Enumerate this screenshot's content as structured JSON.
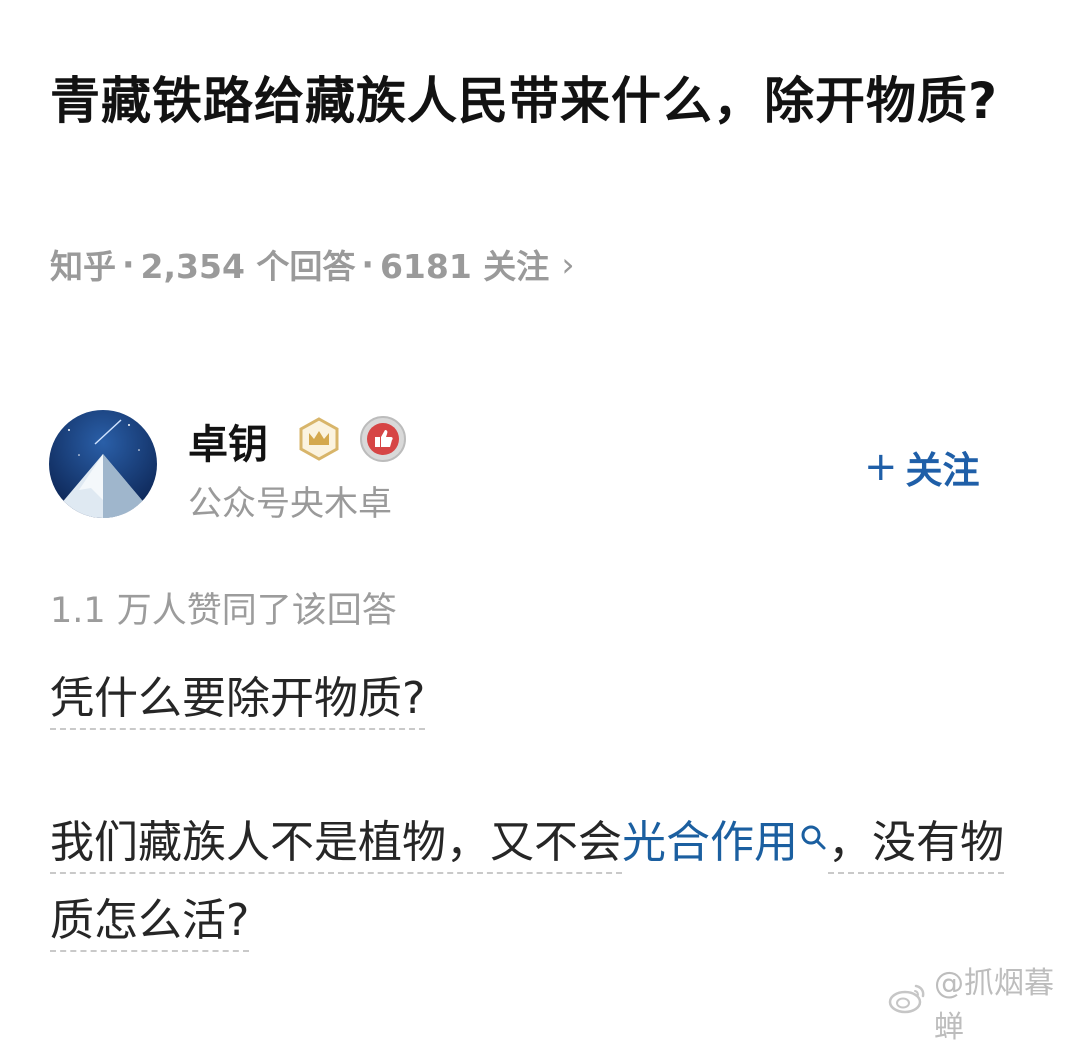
{
  "question": {
    "title": "青藏铁路给藏族人民带来什么，除开物质?",
    "source": "知乎",
    "sep": "·",
    "answers": "2,354 个回答",
    "follows": "6181 关注",
    "chevron": "›"
  },
  "author": {
    "name": "卓钥",
    "bio": "公众号央木卓",
    "badges": [
      "crown-badge-icon",
      "thumbs-up-badge-icon"
    ],
    "follow_label": "关注",
    "follow_plus": "+"
  },
  "answer": {
    "votes": "1.1 万人赞同了该回答",
    "para1": "凭什么要除开物质?",
    "para2_pre": "我们藏族人不是植物，又不会",
    "para2_link": "光合作用",
    "para2_post": "，没有物质怎么活?"
  },
  "watermark": {
    "text": "@抓烟暮蝉",
    "icon": "weibo-icon"
  },
  "colors": {
    "link": "#1b5fa0",
    "follow": "#1f5fa8",
    "meta": "#9a9a9a"
  }
}
